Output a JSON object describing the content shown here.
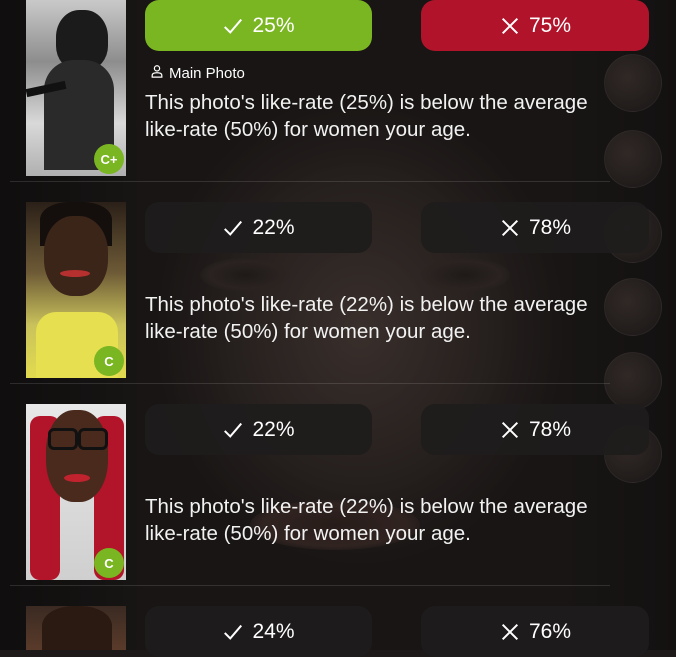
{
  "rows": [
    {
      "like_label": "25%",
      "pass_label": "75%",
      "highlighted": true,
      "tag": "Main Photo",
      "grade": "C+",
      "message_line1": "This photo's like-rate (25%) is below the average",
      "message_line2": "like-rate (50%) for women your age."
    },
    {
      "like_label": "22%",
      "pass_label": "78%",
      "highlighted": false,
      "tag": "",
      "grade": "C",
      "message_line1": "This photo's like-rate (22%) is below the average",
      "message_line2": "like-rate (50%) for women your age."
    },
    {
      "like_label": "22%",
      "pass_label": "78%",
      "highlighted": false,
      "tag": "",
      "grade": "C",
      "message_line1": "This photo's like-rate (22%) is below the average",
      "message_line2": "like-rate (50%) for women your age."
    },
    {
      "like_label": "24%",
      "pass_label": "76%",
      "highlighted": false,
      "tag": "",
      "grade": "",
      "message_line1": "",
      "message_line2": ""
    }
  ],
  "colors": {
    "like_active": "#7ab522",
    "pass_active": "#b1142a",
    "button_dark": "#1e1c1c",
    "grade_badge": "#7ab522"
  },
  "icons": {
    "like": "check-icon",
    "pass": "x-icon",
    "tag": "person-icon"
  }
}
